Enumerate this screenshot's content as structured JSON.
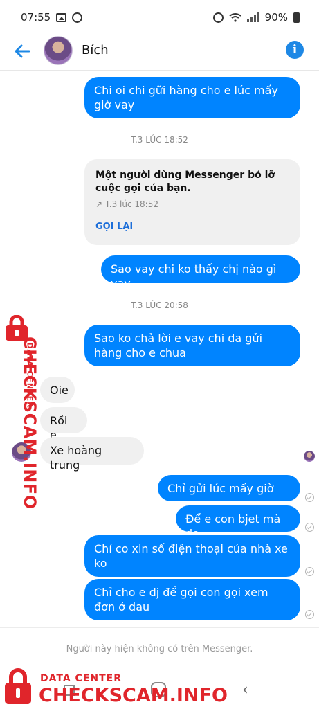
{
  "status_bar": {
    "time": "07:55",
    "battery": "90%"
  },
  "header": {
    "contact_name": "Bích",
    "back_icon": "back-arrow-icon",
    "info_icon": "info-icon",
    "accent_color": "#1e88e5"
  },
  "messages": [
    {
      "from": "me",
      "text": "Chi oi chi gữi hàng cho e lúc mấy giờ vay"
    },
    {
      "type": "timestamp",
      "text": "T.3 LÚC 18:52"
    },
    {
      "type": "missed_call",
      "text": "Một người dùng Messenger bỏ lỡ cuộc gọi của bạn.",
      "time": "↗ T.3 lúc 18:52",
      "action": "GỌI LẠI"
    },
    {
      "from": "me",
      "text": "Sao vay chi ko thấy chị nào gì vay"
    },
    {
      "type": "timestamp",
      "text": "T.3 LÚC 20:58"
    },
    {
      "from": "me",
      "text": "Sao ko chả lời e vay chi  da gửi hàng cho e chua"
    },
    {
      "from": "them",
      "text": "Oie"
    },
    {
      "from": "them",
      "text": "Rồi e"
    },
    {
      "from": "them",
      "text": "Xe hoàng trung"
    },
    {
      "from": "me",
      "text": "Chỉ gửi lúc mấy giờ vay"
    },
    {
      "from": "me",
      "text": "Để e con bjet mà do"
    },
    {
      "from": "me",
      "text": "Chỉ co xin số điện thoại của nhà xe ko"
    },
    {
      "from": "me",
      "text": "Chỉ cho e dj để gọi con gọi xem đơn ở dau"
    }
  ],
  "footer": {
    "note": "Người này hiện không có trên Messenger."
  },
  "watermark": {
    "small_text": "DATA CENTER",
    "big_text": "CHECKSCAM.INFO",
    "color": "#e0252b"
  },
  "colors": {
    "outgoing_bubble": "#0084ff",
    "incoming_bubble": "#f0f0f0"
  }
}
